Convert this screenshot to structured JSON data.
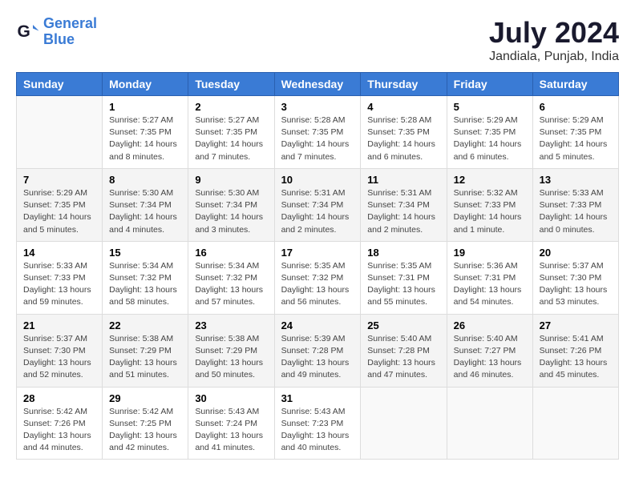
{
  "header": {
    "logo_line1": "General",
    "logo_line2": "Blue",
    "main_title": "July 2024",
    "subtitle": "Jandiala, Punjab, India"
  },
  "weekdays": [
    "Sunday",
    "Monday",
    "Tuesday",
    "Wednesday",
    "Thursday",
    "Friday",
    "Saturday"
  ],
  "weeks": [
    [
      {
        "day": "",
        "info": ""
      },
      {
        "day": "1",
        "info": "Sunrise: 5:27 AM\nSunset: 7:35 PM\nDaylight: 14 hours\nand 8 minutes."
      },
      {
        "day": "2",
        "info": "Sunrise: 5:27 AM\nSunset: 7:35 PM\nDaylight: 14 hours\nand 7 minutes."
      },
      {
        "day": "3",
        "info": "Sunrise: 5:28 AM\nSunset: 7:35 PM\nDaylight: 14 hours\nand 7 minutes."
      },
      {
        "day": "4",
        "info": "Sunrise: 5:28 AM\nSunset: 7:35 PM\nDaylight: 14 hours\nand 6 minutes."
      },
      {
        "day": "5",
        "info": "Sunrise: 5:29 AM\nSunset: 7:35 PM\nDaylight: 14 hours\nand 6 minutes."
      },
      {
        "day": "6",
        "info": "Sunrise: 5:29 AM\nSunset: 7:35 PM\nDaylight: 14 hours\nand 5 minutes."
      }
    ],
    [
      {
        "day": "7",
        "info": "Sunrise: 5:29 AM\nSunset: 7:35 PM\nDaylight: 14 hours\nand 5 minutes."
      },
      {
        "day": "8",
        "info": "Sunrise: 5:30 AM\nSunset: 7:34 PM\nDaylight: 14 hours\nand 4 minutes."
      },
      {
        "day": "9",
        "info": "Sunrise: 5:30 AM\nSunset: 7:34 PM\nDaylight: 14 hours\nand 3 minutes."
      },
      {
        "day": "10",
        "info": "Sunrise: 5:31 AM\nSunset: 7:34 PM\nDaylight: 14 hours\nand 2 minutes."
      },
      {
        "day": "11",
        "info": "Sunrise: 5:31 AM\nSunset: 7:34 PM\nDaylight: 14 hours\nand 2 minutes."
      },
      {
        "day": "12",
        "info": "Sunrise: 5:32 AM\nSunset: 7:33 PM\nDaylight: 14 hours\nand 1 minute."
      },
      {
        "day": "13",
        "info": "Sunrise: 5:33 AM\nSunset: 7:33 PM\nDaylight: 14 hours\nand 0 minutes."
      }
    ],
    [
      {
        "day": "14",
        "info": "Sunrise: 5:33 AM\nSunset: 7:33 PM\nDaylight: 13 hours\nand 59 minutes."
      },
      {
        "day": "15",
        "info": "Sunrise: 5:34 AM\nSunset: 7:32 PM\nDaylight: 13 hours\nand 58 minutes."
      },
      {
        "day": "16",
        "info": "Sunrise: 5:34 AM\nSunset: 7:32 PM\nDaylight: 13 hours\nand 57 minutes."
      },
      {
        "day": "17",
        "info": "Sunrise: 5:35 AM\nSunset: 7:32 PM\nDaylight: 13 hours\nand 56 minutes."
      },
      {
        "day": "18",
        "info": "Sunrise: 5:35 AM\nSunset: 7:31 PM\nDaylight: 13 hours\nand 55 minutes."
      },
      {
        "day": "19",
        "info": "Sunrise: 5:36 AM\nSunset: 7:31 PM\nDaylight: 13 hours\nand 54 minutes."
      },
      {
        "day": "20",
        "info": "Sunrise: 5:37 AM\nSunset: 7:30 PM\nDaylight: 13 hours\nand 53 minutes."
      }
    ],
    [
      {
        "day": "21",
        "info": "Sunrise: 5:37 AM\nSunset: 7:30 PM\nDaylight: 13 hours\nand 52 minutes."
      },
      {
        "day": "22",
        "info": "Sunrise: 5:38 AM\nSunset: 7:29 PM\nDaylight: 13 hours\nand 51 minutes."
      },
      {
        "day": "23",
        "info": "Sunrise: 5:38 AM\nSunset: 7:29 PM\nDaylight: 13 hours\nand 50 minutes."
      },
      {
        "day": "24",
        "info": "Sunrise: 5:39 AM\nSunset: 7:28 PM\nDaylight: 13 hours\nand 49 minutes."
      },
      {
        "day": "25",
        "info": "Sunrise: 5:40 AM\nSunset: 7:28 PM\nDaylight: 13 hours\nand 47 minutes."
      },
      {
        "day": "26",
        "info": "Sunrise: 5:40 AM\nSunset: 7:27 PM\nDaylight: 13 hours\nand 46 minutes."
      },
      {
        "day": "27",
        "info": "Sunrise: 5:41 AM\nSunset: 7:26 PM\nDaylight: 13 hours\nand 45 minutes."
      }
    ],
    [
      {
        "day": "28",
        "info": "Sunrise: 5:42 AM\nSunset: 7:26 PM\nDaylight: 13 hours\nand 44 minutes."
      },
      {
        "day": "29",
        "info": "Sunrise: 5:42 AM\nSunset: 7:25 PM\nDaylight: 13 hours\nand 42 minutes."
      },
      {
        "day": "30",
        "info": "Sunrise: 5:43 AM\nSunset: 7:24 PM\nDaylight: 13 hours\nand 41 minutes."
      },
      {
        "day": "31",
        "info": "Sunrise: 5:43 AM\nSunset: 7:23 PM\nDaylight: 13 hours\nand 40 minutes."
      },
      {
        "day": "",
        "info": ""
      },
      {
        "day": "",
        "info": ""
      },
      {
        "day": "",
        "info": ""
      }
    ]
  ]
}
